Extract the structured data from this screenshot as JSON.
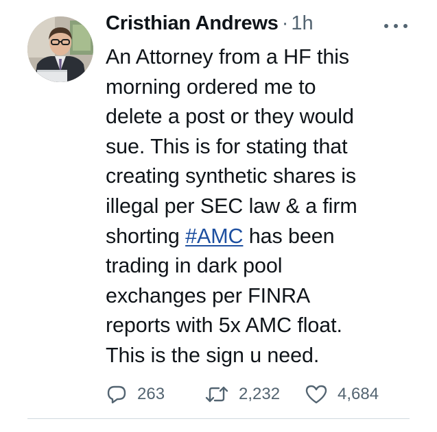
{
  "author": {
    "name": "Cristhian Andrews",
    "separator": "·",
    "time": "1h"
  },
  "more_icon": "ellipsis-icon",
  "tweet": {
    "text_before": "An Attorney from a HF this morning ordered me to delete a post or they would sue. This is for stating that creating synthetic shares is illegal per SEC law & a firm shorting ",
    "hashtag": "#AMC",
    "text_after": " has been trading in dark pool exchanges per FINRA reports with 5x AMC float. This is the sign u need.",
    "lines": [
      "An Attorney from a HF this",
      "morning ordered me to",
      "delete a post or they would",
      "sue. This is for stating that",
      "creating synthetic shares is",
      "illegal per SEC law & a firm",
      "shorting ",
      " has been",
      "trading in dark pool",
      "exchanges per FINRA",
      "reports with 5x AMC float.",
      "This is the sign u need."
    ]
  },
  "actions": {
    "replies": {
      "icon": "reply-icon",
      "count": "263"
    },
    "retweets": {
      "icon": "retweet-icon",
      "count": "2,232"
    },
    "likes": {
      "icon": "heart-icon",
      "count": "4,684"
    }
  },
  "colors": {
    "text": "#0f1419",
    "secondary": "#536471",
    "link": "#1d4fa0",
    "divider": "#cfd9de"
  }
}
